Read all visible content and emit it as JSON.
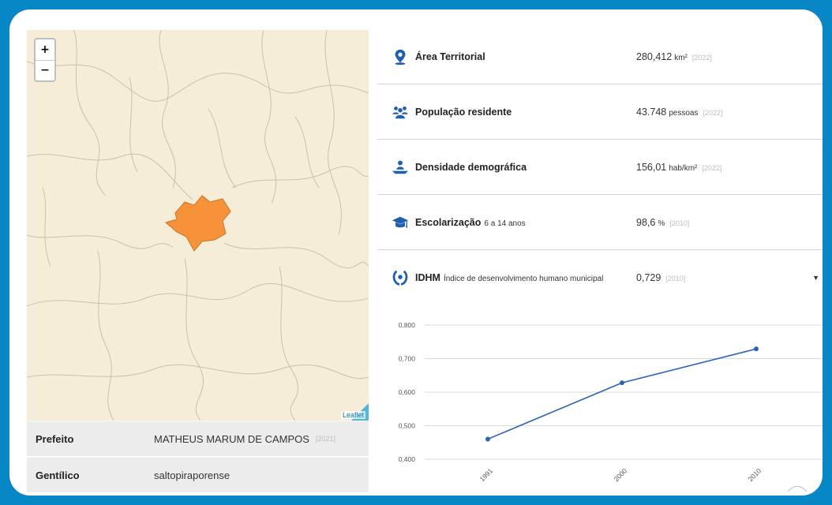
{
  "map": {
    "zoom_in": "+",
    "zoom_out": "−",
    "attribution": "Leaflet",
    "highlight_color": "#f7923a",
    "border_color": "#c9c0aa",
    "background_color": "#f6edd8"
  },
  "info": [
    {
      "label": "Prefeito",
      "value": "MATHEUS MARUM DE CAMPOS",
      "year": "[2021]"
    },
    {
      "label": "Gentílico",
      "value": "saltopiraporense",
      "year": ""
    }
  ],
  "indicators": [
    {
      "icon": "location-pin-icon",
      "name": "Área Territorial",
      "note": "",
      "value": "280,412",
      "unit": "km²",
      "year": "[2022]"
    },
    {
      "icon": "people-icon",
      "name": "População residente",
      "note": "",
      "value": "43.748",
      "unit": "pessoas",
      "year": "[2022]"
    },
    {
      "icon": "density-icon",
      "name": "Densidade demográfica",
      "note": "",
      "value": "156,01",
      "unit": "hab/km²",
      "year": "[2022]"
    },
    {
      "icon": "graduation-cap-icon",
      "name": "Escolarização",
      "note": "6 a 14 anos",
      "value": "98,6",
      "unit": "%",
      "year": "[2010]"
    },
    {
      "icon": "laurel-icon",
      "name": "IDHM",
      "note": "Índice de desenvolvimento humano municipal",
      "value": "0,729",
      "unit": "",
      "year": "[2010]"
    }
  ],
  "icon_color": "#1f5fb0",
  "chart_data": {
    "type": "line",
    "categories": [
      "1991",
      "2000",
      "2010"
    ],
    "series": [
      {
        "values": [
          0.46,
          0.628,
          0.729
        ]
      }
    ],
    "y_ticks": [
      "0,400",
      "0,500",
      "0,600",
      "0,700",
      "0,800"
    ],
    "ylim": [
      0.4,
      0.8
    ],
    "grid": true,
    "line_color": "#2b63b5"
  }
}
